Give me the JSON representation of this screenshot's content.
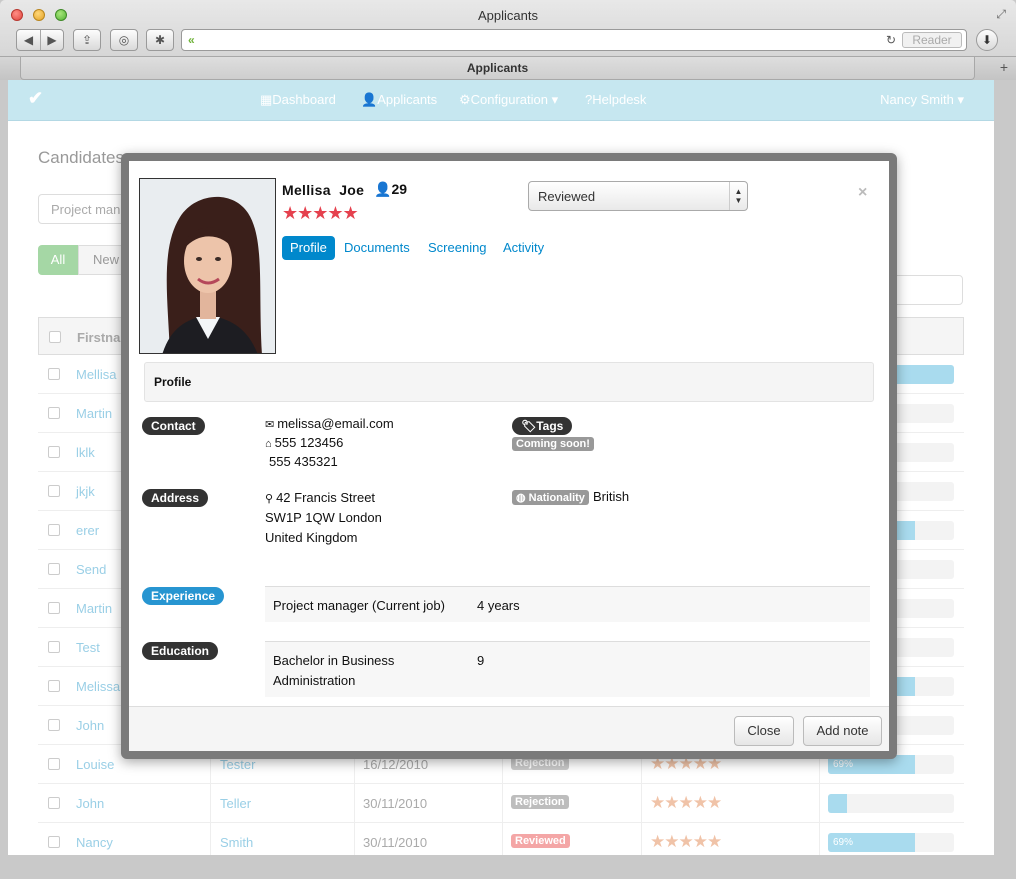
{
  "browser": {
    "window_title": "Applicants",
    "tab_title": "Applicants",
    "reader_label": "Reader",
    "url": ""
  },
  "navbar": {
    "brand": "✔",
    "items": [
      {
        "icon": "dashboard-icon",
        "label": "Dashboard"
      },
      {
        "icon": "user-icon",
        "label": "Applicants"
      },
      {
        "icon": "gear-icon",
        "label": "Configuration ▾"
      },
      {
        "icon": "help-icon",
        "label": "Helpdesk"
      }
    ],
    "user": "Nancy Smith ▾"
  },
  "background_page": {
    "title": "Candidates",
    "search_placeholder": "Project man",
    "filters": [
      "All",
      "New"
    ],
    "table_header": "Firstnam",
    "rows": [
      {
        "first": "Mellisa",
        "last": "",
        "date": "",
        "status": "",
        "status_color": "",
        "stars": "",
        "bar": 1.0,
        "bar_label": ""
      },
      {
        "first": "Martin",
        "last": "",
        "date": "",
        "status": "",
        "status_color": "",
        "stars": "",
        "bar": 0,
        "bar_label": ""
      },
      {
        "first": "lklk",
        "last": "",
        "date": "",
        "status": "",
        "status_color": "",
        "stars": "",
        "bar": 0,
        "bar_label": ""
      },
      {
        "first": "jkjk",
        "last": "",
        "date": "",
        "status": "",
        "status_color": "",
        "stars": "",
        "bar": 0,
        "bar_label": ""
      },
      {
        "first": "erer",
        "last": "",
        "date": "",
        "status": "",
        "status_color": "",
        "stars": "",
        "bar": 0.69,
        "bar_label": ""
      },
      {
        "first": "Send",
        "last": "",
        "date": "",
        "status": "",
        "status_color": "",
        "stars": "",
        "bar": 0,
        "bar_label": ""
      },
      {
        "first": "Martin",
        "last": "",
        "date": "",
        "status": "",
        "status_color": "",
        "stars": "",
        "bar": 0,
        "bar_label": ""
      },
      {
        "first": "Test",
        "last": "",
        "date": "",
        "status": "",
        "status_color": "",
        "stars": "",
        "bar": 0,
        "bar_label": ""
      },
      {
        "first": "Melissa",
        "last": "",
        "date": "",
        "status": "",
        "status_color": "",
        "stars": "",
        "bar": 0.69,
        "bar_label": ""
      },
      {
        "first": "John",
        "last": "",
        "date": "",
        "status": "",
        "status_color": "",
        "stars": "",
        "bar": 0,
        "bar_label": ""
      },
      {
        "first": "Louise",
        "last": "Tester",
        "date": "16/12/2010",
        "status": "Rejection",
        "status_color": "#c9c9c9",
        "stars": "★★★★★",
        "bar": 0.69,
        "bar_label": "69%"
      },
      {
        "first": "John",
        "last": "Teller",
        "date": "30/11/2010",
        "status": "Rejection",
        "status_color": "#bdbdbd",
        "stars": "★★★★★",
        "bar": 0.15,
        "bar_label": ""
      },
      {
        "first": "Nancy",
        "last": "Smith",
        "date": "30/11/2010",
        "status": "Reviewed",
        "status_color": "#f4a6a6",
        "stars": "★★★★★",
        "bar": 0.69,
        "bar_label": "69%"
      }
    ]
  },
  "modal": {
    "first_name": "Mellisa",
    "last_name": "Joe",
    "age": "29",
    "rating": 5,
    "stars": "★★★★★",
    "status": "Reviewed",
    "tabs": [
      "Profile",
      "Documents",
      "Screening",
      "Activity"
    ],
    "active_tab": "Profile",
    "section_title": "Profile",
    "contact_label": "Contact",
    "email": "melissa@email.com",
    "phone1": "555 123456",
    "phone2": "555 435321",
    "tags_label": "Tags",
    "tags_value": "Coming soon!",
    "address_label": "Address",
    "address_line1": "42 Francis Street",
    "address_line2": "SW1P 1QW London",
    "address_line3": "United Kingdom",
    "nationality_label": "Nationality",
    "nationality": "British",
    "experience_label": "Experience",
    "experience_role": "Project manager (Current job)",
    "experience_years": "4 years",
    "education_label": "Education",
    "education_degree_1": "Bachelor in Business",
    "education_degree_2": "Administration",
    "education_value": "9",
    "close_button": "Close",
    "add_note_button": "Add note"
  },
  "colors": {
    "navbar": "#c6e7f0",
    "primary": "#0088cc",
    "star": "#e5414e",
    "experience_badge": "#2795d1"
  }
}
